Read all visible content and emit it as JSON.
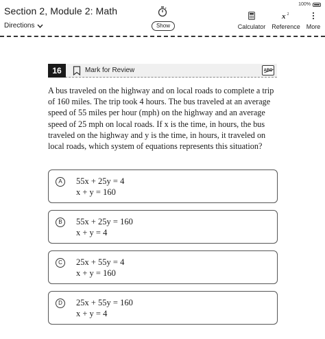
{
  "status": {
    "battery": "100%"
  },
  "header": {
    "title": "Section 2, Module 2: Math",
    "directions_label": "Directions",
    "show_label": "Show",
    "tools": [
      {
        "label": "Calculator",
        "icon": "calculator-icon"
      },
      {
        "label": "Reference",
        "icon": "reference-icon"
      },
      {
        "label": "More",
        "icon": "more-icon"
      }
    ]
  },
  "question": {
    "number": "16",
    "mark_label": "Mark for Review",
    "abc_label": "ABC",
    "text": "A bus traveled on the highway and on local roads to complete a trip of 160 miles. The trip took 4 hours. The bus traveled at an average speed of 55 miles per hour (mph) on the highway and an average speed of 25 mph on local roads. If x is the time, in hours, the bus traveled on the highway and y is the time, in hours, it traveled on local roads, which system of equations represents this situation?"
  },
  "choices": [
    {
      "letter": "A",
      "eq1": "55x + 25y = 4",
      "eq2": "x + y = 160"
    },
    {
      "letter": "B",
      "eq1": "55x + 25y = 160",
      "eq2": "x + y = 4"
    },
    {
      "letter": "C",
      "eq1": "25x + 55y = 4",
      "eq2": "x + y = 160"
    },
    {
      "letter": "D",
      "eq1": "25x + 55y = 160",
      "eq2": "x + y = 4"
    }
  ]
}
